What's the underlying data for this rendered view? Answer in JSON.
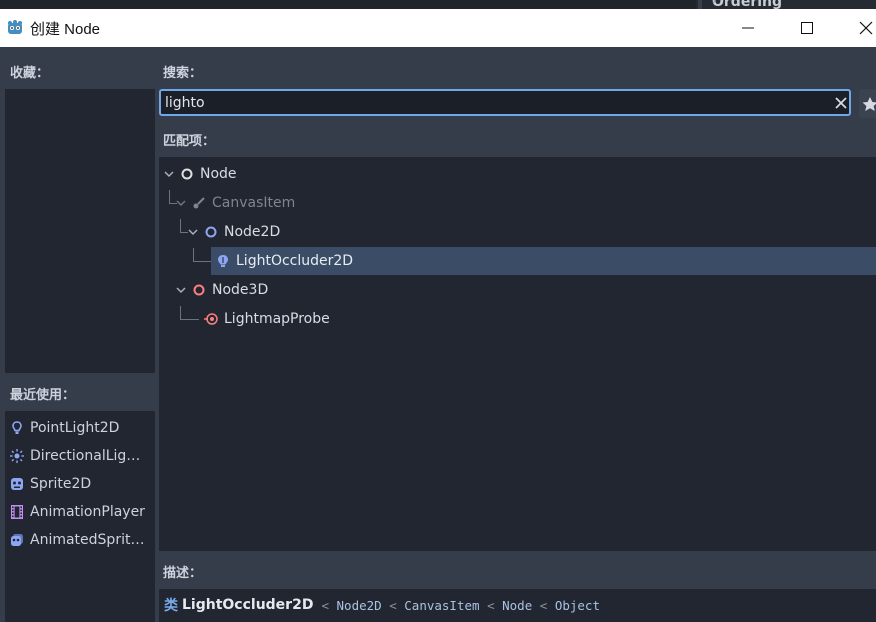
{
  "background": {
    "inspector_section": "Ordering"
  },
  "window": {
    "title": "创建 Node"
  },
  "favorites": {
    "label": "收藏："
  },
  "search": {
    "label": "搜索：",
    "value": "lighto"
  },
  "matches": {
    "label": "匹配项：",
    "tree": [
      {
        "label": "Node",
        "icon": "node-circle-icon",
        "color": "#e0e0e0",
        "dimmed": false
      },
      {
        "label": "CanvasItem",
        "icon": "brush-icon",
        "color": "#7f8590",
        "dimmed": true
      },
      {
        "label": "Node2D",
        "icon": "node2d-circle-icon",
        "color": "#8da5f3",
        "dimmed": false
      },
      {
        "label": "LightOccluder2D",
        "icon": "light-occluder-icon",
        "color": "#8da5f3",
        "dimmed": false,
        "selected": true
      },
      {
        "label": "Node3D",
        "icon": "node3d-circle-icon",
        "color": "#fc7f7f",
        "dimmed": false
      },
      {
        "label": "LightmapProbe",
        "icon": "lightmap-probe-icon",
        "color": "#fc7f7f",
        "dimmed": false
      }
    ]
  },
  "recent": {
    "label": "最近使用：",
    "items": [
      {
        "label": "PointLight2D",
        "icon": "point-light-icon"
      },
      {
        "label": "DirectionalLight…",
        "icon": "directional-light-icon"
      },
      {
        "label": "Sprite2D",
        "icon": "sprite-icon"
      },
      {
        "label": "AnimationPlayer",
        "icon": "film-strip-icon"
      },
      {
        "label": "AnimatedSprite…",
        "icon": "animated-sprite-icon"
      }
    ]
  },
  "description": {
    "label": "描述：",
    "kind": "类",
    "class_name": "LightOccluder2D",
    "inheritance": [
      "Node2D",
      "CanvasItem",
      "Node",
      "Object"
    ],
    "separator": "<"
  },
  "colors": {
    "accent": "#6fa7e8",
    "node2d": "#8da5f3",
    "node3d": "#fc7f7f",
    "selection": "#3b4d66"
  }
}
